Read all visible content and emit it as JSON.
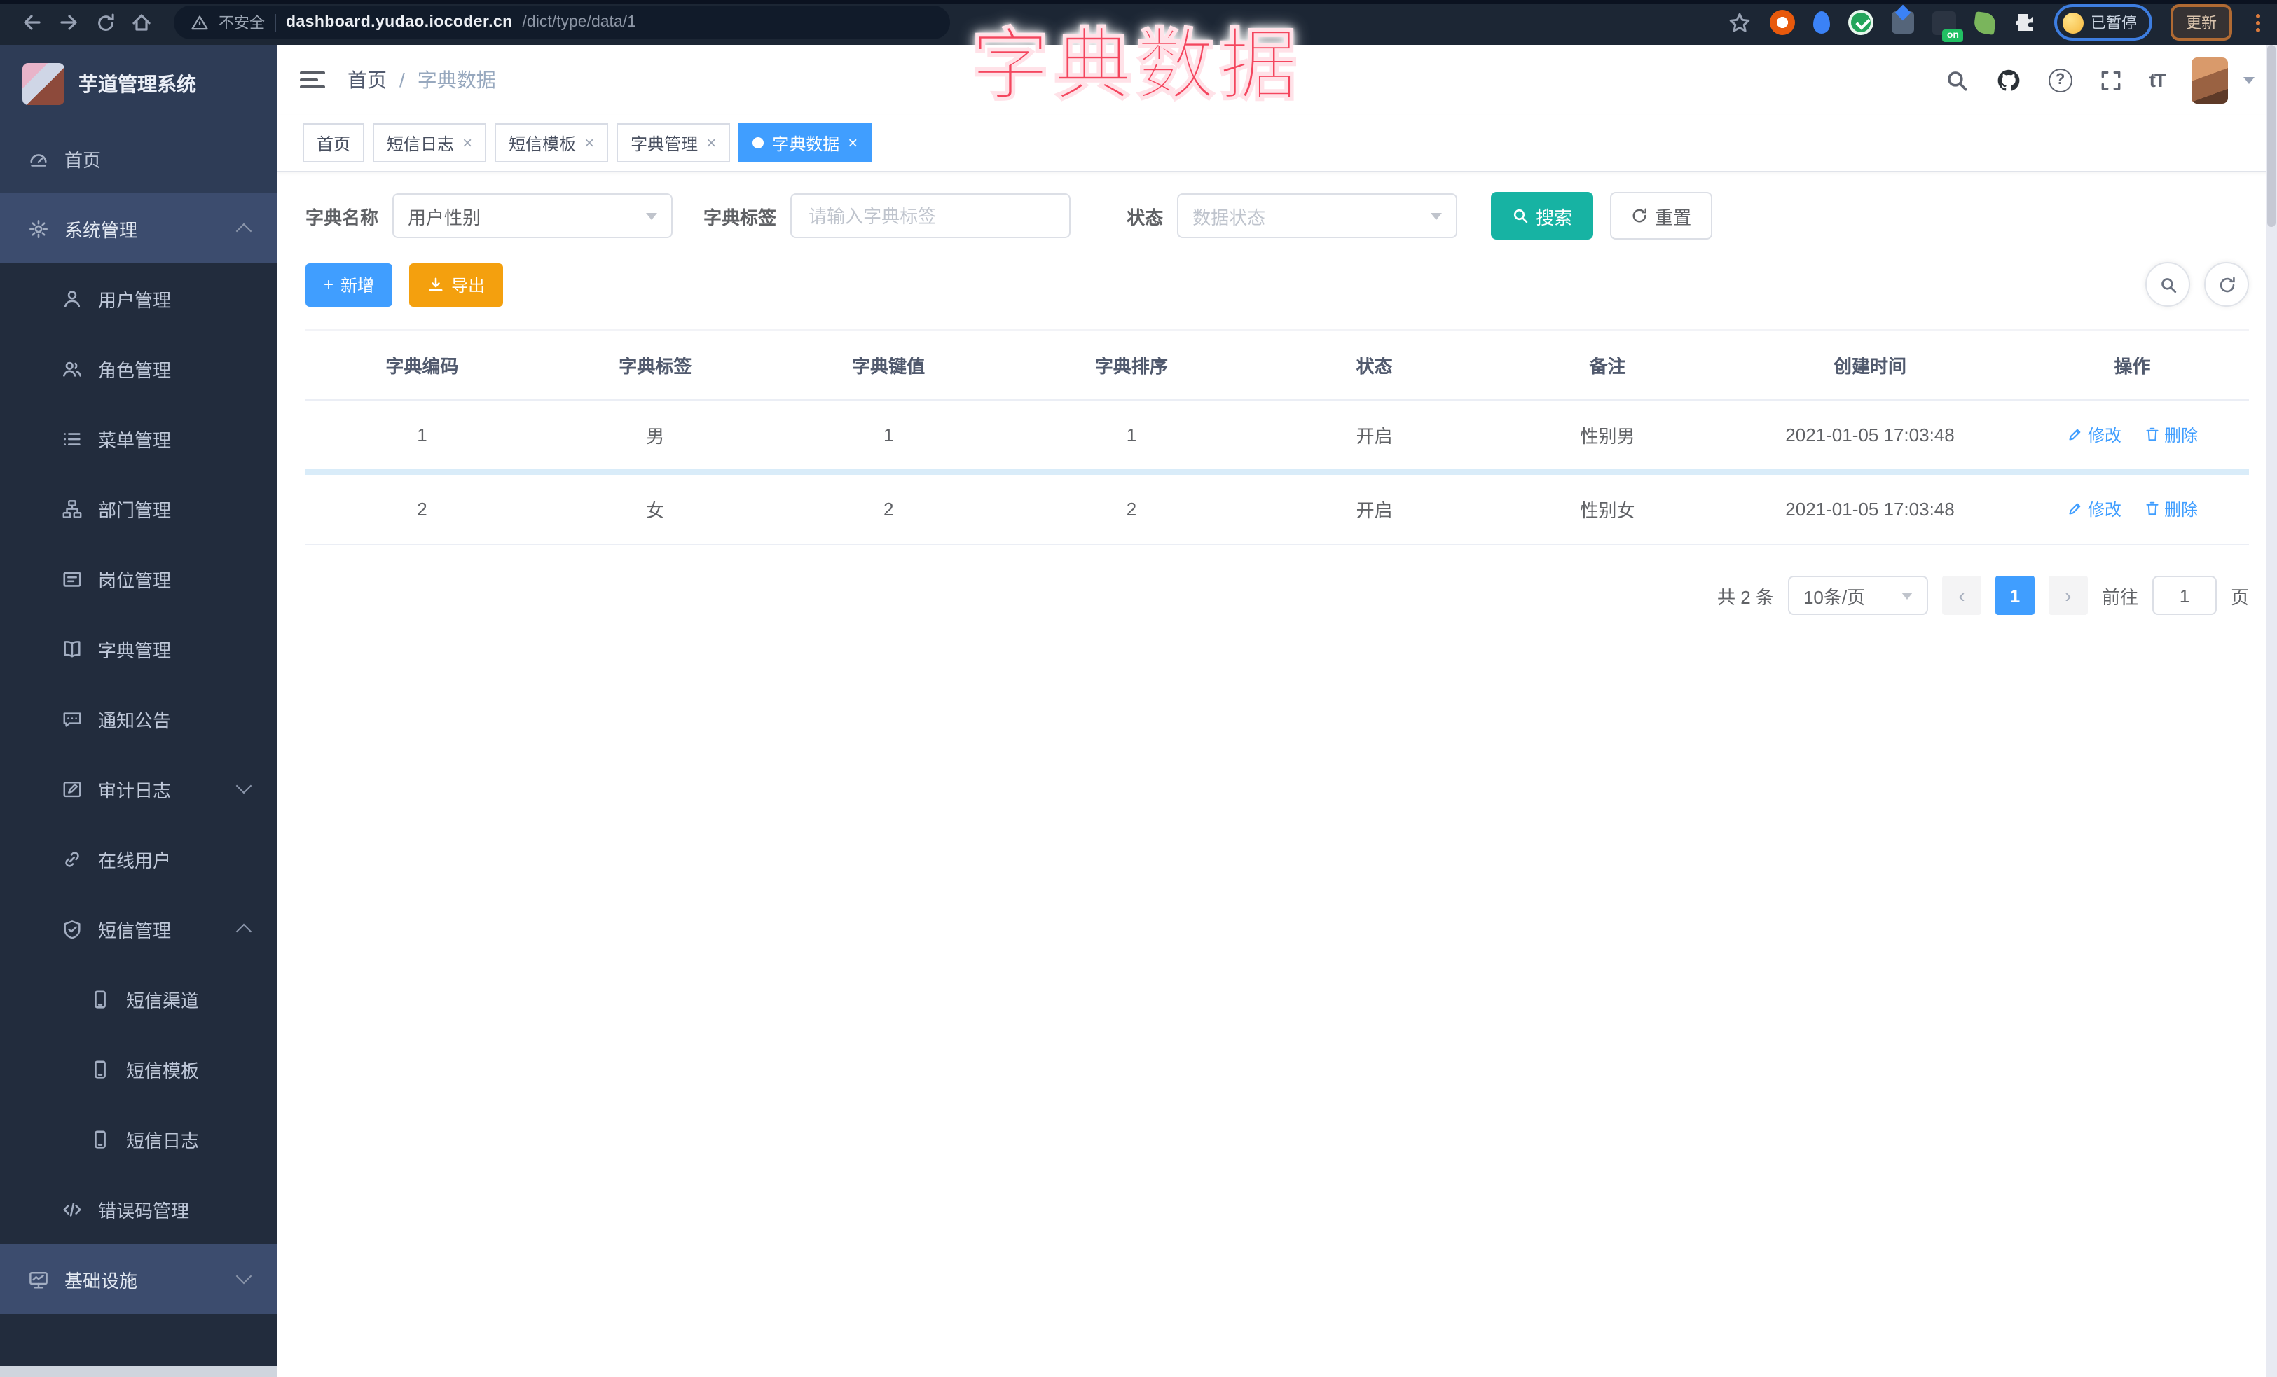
{
  "browser": {
    "security_label": "不安全",
    "url_host": "dashboard.yudao.iocoder.cn",
    "url_path": "/dict/type/data/1",
    "extension_badge": "on",
    "paused_label": "已暂停",
    "update_label": "更新"
  },
  "overlay_title": "字典数据",
  "app": {
    "logo_title": "芋道管理系统",
    "breadcrumb": {
      "home": "首页",
      "separator": "/",
      "current": "字典数据"
    }
  },
  "sidebar": {
    "items": [
      {
        "label": "首页"
      },
      {
        "label": "系统管理"
      },
      {
        "label": "用户管理"
      },
      {
        "label": "角色管理"
      },
      {
        "label": "菜单管理"
      },
      {
        "label": "部门管理"
      },
      {
        "label": "岗位管理"
      },
      {
        "label": "字典管理"
      },
      {
        "label": "通知公告"
      },
      {
        "label": "审计日志"
      },
      {
        "label": "在线用户"
      },
      {
        "label": "短信管理"
      },
      {
        "label": "短信渠道"
      },
      {
        "label": "短信模板"
      },
      {
        "label": "短信日志"
      },
      {
        "label": "错误码管理"
      },
      {
        "label": "基础设施"
      }
    ]
  },
  "tabs": [
    {
      "label": "首页"
    },
    {
      "label": "短信日志"
    },
    {
      "label": "短信模板"
    },
    {
      "label": "字典管理"
    },
    {
      "label": "字典数据"
    }
  ],
  "filters": {
    "dict_name_label": "字典名称",
    "dict_name_value": "用户性别",
    "dict_label_label": "字典标签",
    "dict_label_placeholder": "请输入字典标签",
    "status_label": "状态",
    "status_placeholder": "数据状态",
    "search_label": "搜索",
    "reset_label": "重置"
  },
  "toolbar": {
    "add_label": "新增",
    "export_label": "导出"
  },
  "table": {
    "columns": [
      "字典编码",
      "字典标签",
      "字典键值",
      "字典排序",
      "状态",
      "备注",
      "创建时间",
      "操作"
    ],
    "rows": [
      {
        "code": "1",
        "label": "男",
        "value": "1",
        "sort": "1",
        "status": "开启",
        "remark": "性别男",
        "created": "2021-01-05 17:03:48"
      },
      {
        "code": "2",
        "label": "女",
        "value": "2",
        "sort": "2",
        "status": "开启",
        "remark": "性别女",
        "created": "2021-01-05 17:03:48"
      }
    ],
    "edit_label": "修改",
    "delete_label": "删除"
  },
  "pagination": {
    "total": "共 2 条",
    "page_size": "10条/页",
    "page": "1",
    "goto_label": "前往",
    "goto_value": "1",
    "page_unit": "页"
  },
  "icons": {
    "close": "×",
    "plus": "+",
    "help": "?",
    "font_size": "tT",
    "prev": "‹",
    "next": "›"
  },
  "colors": {
    "accent": "#409eff",
    "search_button": "#17b3a3",
    "export_button": "#f4a00e",
    "overlay_title": "#f4465e"
  }
}
